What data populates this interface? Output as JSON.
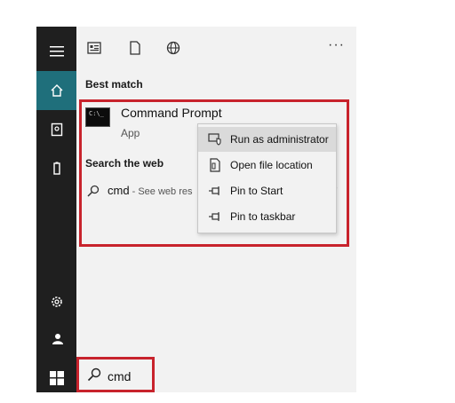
{
  "rail": {
    "items": [
      {
        "name": "menu-icon"
      },
      {
        "name": "home-icon",
        "active": true
      },
      {
        "name": "documents-icon"
      },
      {
        "name": "device-icon"
      },
      {
        "name": "settings-icon"
      },
      {
        "name": "user-icon"
      },
      {
        "name": "windows-start-icon"
      }
    ]
  },
  "toolbar": {
    "icons": [
      "apps-filter-icon",
      "documents-filter-icon",
      "web-filter-icon"
    ],
    "more_label": "···"
  },
  "results": {
    "best_match_header": "Best match",
    "best_match": {
      "title": "Command Prompt",
      "subtitle": "App",
      "icon_text": "C:\\_"
    },
    "web_header": "Search the web",
    "web_query": "cmd",
    "web_hint": " - See web res",
    "web_arrow": "›"
  },
  "context_menu": {
    "items": [
      {
        "label": "Run as administrator",
        "icon": "admin-shield-icon",
        "hovered": true
      },
      {
        "label": "Open file location",
        "icon": "file-location-icon"
      },
      {
        "label": "Pin to Start",
        "icon": "pin-icon"
      },
      {
        "label": "Pin to taskbar",
        "icon": "pin-icon"
      }
    ]
  },
  "search": {
    "value": "cmd"
  },
  "colors": {
    "rail_bg": "#1f1f1f",
    "active_accent": "#1f6f7b",
    "panel_bg": "#f2f2f2",
    "highlight": "#c8232c"
  }
}
